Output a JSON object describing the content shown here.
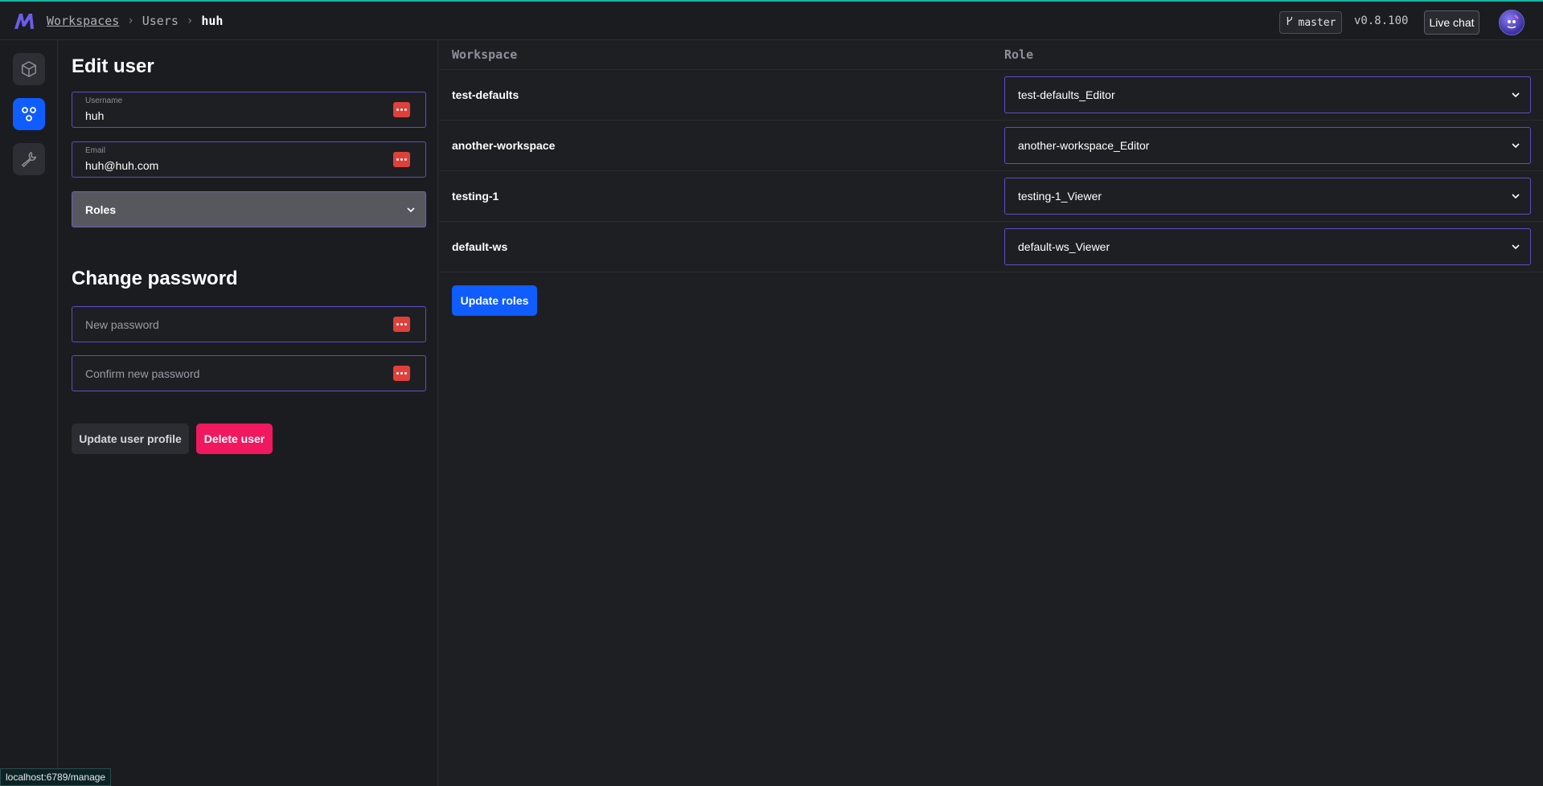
{
  "colors": {
    "accent_top_line": "#14b8a6",
    "primary": "#0f5cff",
    "danger": "#f0185e",
    "field_border": "#5b4fc4",
    "password_manager_icon": "#e0403a"
  },
  "header": {
    "breadcrumb": {
      "workspaces": "Workspaces",
      "users": "Users",
      "current": "huh"
    },
    "branch": "master",
    "version": "v0.8.100",
    "live_chat": "Live chat"
  },
  "sidebar": {
    "items": [
      {
        "name": "workspaces-nav",
        "icon": "cube-icon",
        "active": false
      },
      {
        "name": "users-nav",
        "icon": "people-icon",
        "active": true
      },
      {
        "name": "settings-nav",
        "icon": "wrench-icon",
        "active": false
      }
    ]
  },
  "edit_user": {
    "title": "Edit user",
    "username_label": "Username",
    "username_value": "huh",
    "email_label": "Email",
    "email_value": "huh@huh.com",
    "roles_label": "Roles"
  },
  "change_password": {
    "title": "Change password",
    "new_password_placeholder": "New password",
    "confirm_password_placeholder": "Confirm new password"
  },
  "actions": {
    "update_profile": "Update user profile",
    "delete_user": "Delete user"
  },
  "roles_table": {
    "columns": [
      "Workspace",
      "Role"
    ],
    "rows": [
      {
        "workspace": "test-defaults",
        "role": "test-defaults_Editor"
      },
      {
        "workspace": "another-workspace",
        "role": "another-workspace_Editor"
      },
      {
        "workspace": "testing-1",
        "role": "testing-1_Viewer"
      },
      {
        "workspace": "default-ws",
        "role": "default-ws_Viewer"
      }
    ],
    "update_button": "Update roles"
  },
  "status_bar": {
    "url": "localhost:6789/manage"
  }
}
